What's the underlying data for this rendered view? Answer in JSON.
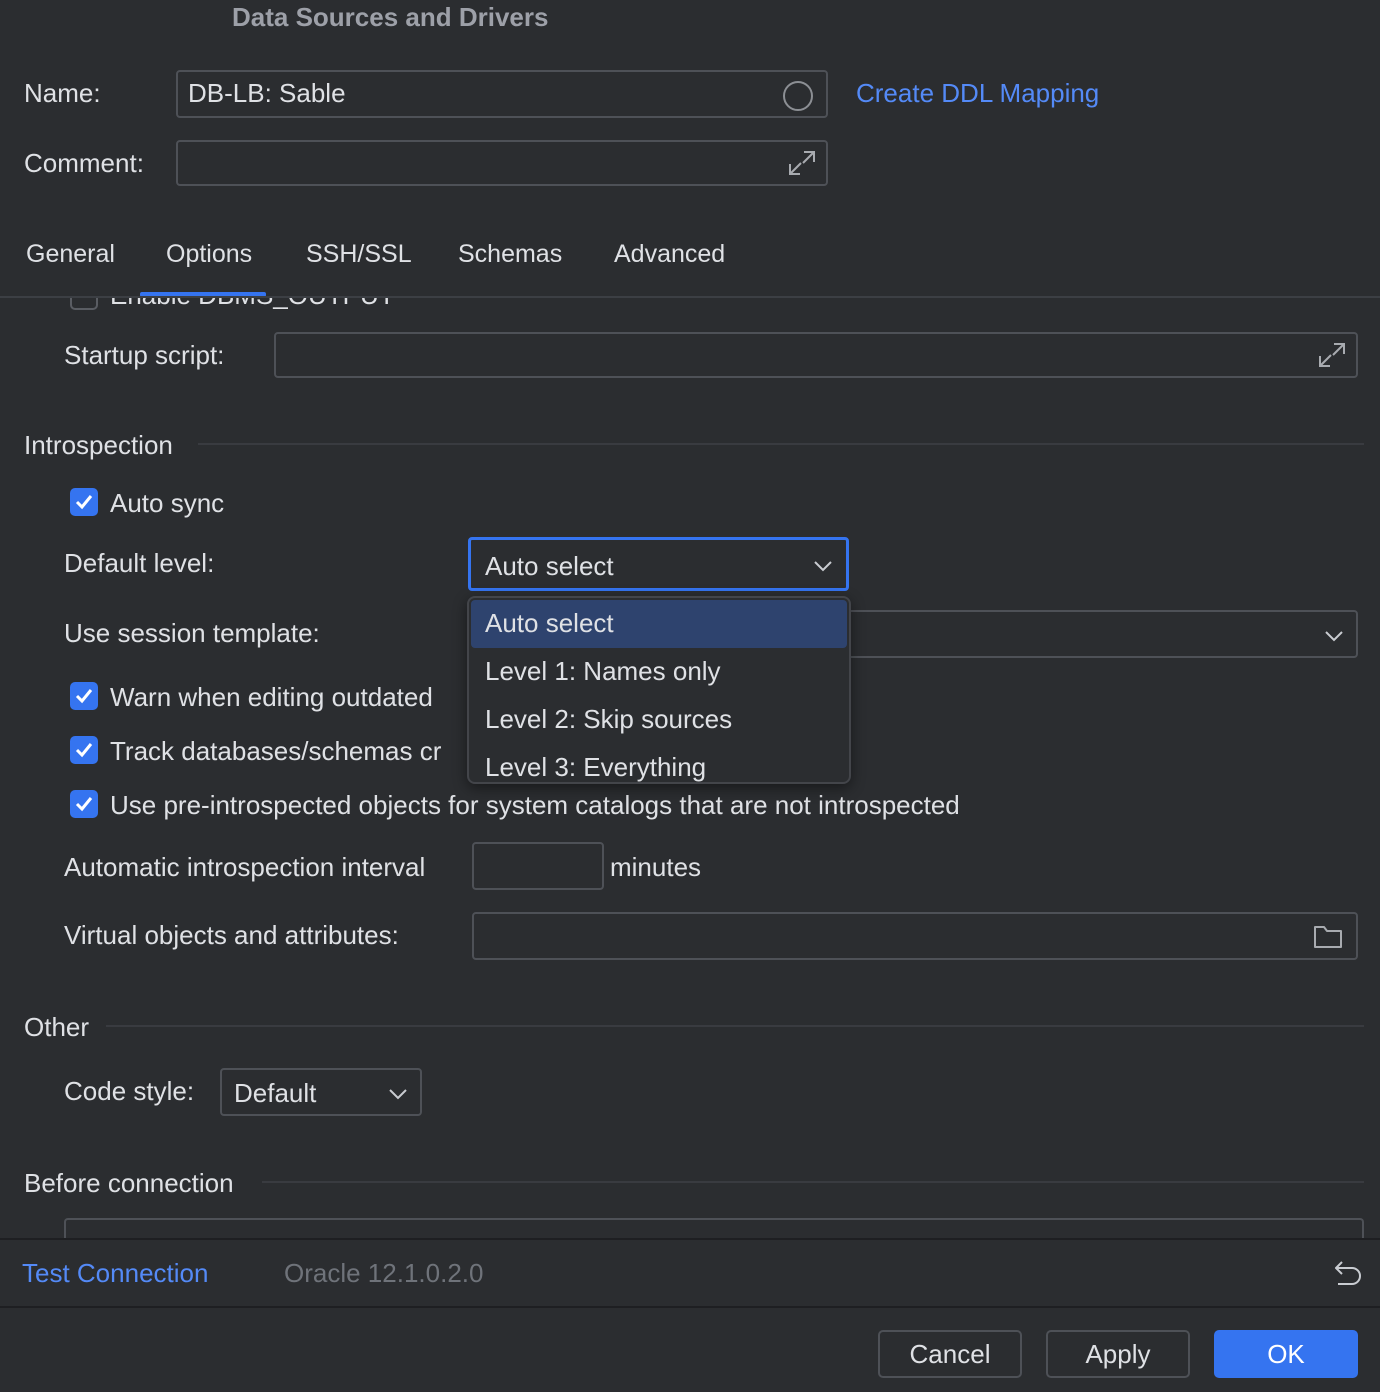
{
  "window": {
    "title": "Data Sources and Drivers"
  },
  "name_field": {
    "label": "Name:",
    "value": "DB-LB: Sable"
  },
  "create_ddl_link": "Create DDL Mapping",
  "comment_field": {
    "label": "Comment:",
    "value": ""
  },
  "tabs": [
    {
      "label": "General",
      "active": false
    },
    {
      "label": "Options",
      "active": true
    },
    {
      "label": "SSH/SSL",
      "active": false
    },
    {
      "label": "Schemas",
      "active": false
    },
    {
      "label": "Advanced",
      "active": false
    }
  ],
  "partial_row": {
    "label": "Enable DBMS_OUTPUT"
  },
  "startup_script": {
    "label": "Startup script:",
    "value": ""
  },
  "introspection": {
    "heading": "Introspection",
    "auto_sync": {
      "label": "Auto sync",
      "checked": true
    },
    "default_level": {
      "label": "Default level:",
      "value": "Auto select"
    },
    "session_template": {
      "label": "Use session template:"
    },
    "warn_outdated": {
      "label": "Warn when editing outdated",
      "checked": true
    },
    "track_databases": {
      "label": "Track databases/schemas cr",
      "checked": true
    },
    "pre_introspected": {
      "label": "Use pre-introspected objects for system catalogs that are not introspected",
      "checked": true
    },
    "interval": {
      "label": "Automatic introspection interval",
      "value": "",
      "unit": "minutes"
    },
    "virtual_objects": {
      "label": "Virtual objects and attributes:",
      "value": ""
    }
  },
  "level_dropdown": {
    "options": [
      "Auto select",
      "Level 1: Names only",
      "Level 2: Skip sources",
      "Level 3: Everything"
    ],
    "selected_index": 0
  },
  "other": {
    "heading": "Other",
    "code_style": {
      "label": "Code style:",
      "value": "Default"
    }
  },
  "before_connection": {
    "heading": "Before connection"
  },
  "footer": {
    "test_connection": "Test Connection",
    "driver_version": "Oracle 12.1.0.2.0"
  },
  "buttons": {
    "cancel": "Cancel",
    "apply": "Apply",
    "ok": "OK"
  },
  "colors": {
    "accent": "#3574f0",
    "link": "#548af7",
    "background": "#2b2d30"
  }
}
